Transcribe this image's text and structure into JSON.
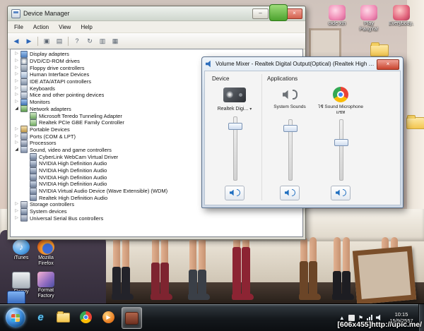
{
  "desktop": {
    "watermark": "[606x455]http://upic.me/",
    "icons": [
      {
        "id": "green-app",
        "label": "",
        "kind": "green-app"
      },
      {
        "id": "doll1",
        "label": "oide xth",
        "kind": "doll-pink"
      },
      {
        "id": "pangya",
        "label": "Play PangYa!",
        "kind": "doll-pink"
      },
      {
        "id": "everybody",
        "label": "Everybody...",
        "kind": "doll-red"
      },
      {
        "id": "folder1",
        "label": "",
        "kind": "folder"
      },
      {
        "id": "folder2",
        "label": "",
        "kind": "folder"
      },
      {
        "id": "itunes",
        "label": "iTunes",
        "kind": "itunes"
      },
      {
        "id": "firefox",
        "label": "Mozilla Firefox",
        "kind": "firefox"
      },
      {
        "id": "grayapp",
        "label": "Floppy",
        "kind": "gray-app"
      },
      {
        "id": "formatfactory",
        "label": "Format Factory",
        "kind": "formatfactory"
      },
      {
        "id": "blueapp",
        "label": "",
        "kind": "blue-app"
      }
    ]
  },
  "device_manager": {
    "title": "Device Manager",
    "menu": [
      "File",
      "Action",
      "View",
      "Help"
    ],
    "toolbar": [
      "back",
      "forward",
      "sep",
      "window",
      "export",
      "sep",
      "help",
      "refresh",
      "scan",
      "properties"
    ],
    "tree": [
      {
        "label": "Display adapters",
        "indent": 1,
        "expand": "collapsed",
        "icon": "display"
      },
      {
        "label": "DVD/CD-ROM drives",
        "indent": 1,
        "expand": "collapsed",
        "icon": "dvd"
      },
      {
        "label": "Floppy drive controllers",
        "indent": 1,
        "expand": "collapsed",
        "icon": "floppy"
      },
      {
        "label": "Human Interface Devices",
        "indent": 1,
        "expand": "collapsed",
        "icon": "hid"
      },
      {
        "label": "IDE ATA/ATAPI controllers",
        "indent": 1,
        "expand": "collapsed",
        "icon": "ide"
      },
      {
        "label": "Keyboards",
        "indent": 1,
        "expand": "collapsed",
        "icon": "keyboard"
      },
      {
        "label": "Mice and other pointing devices",
        "indent": 1,
        "expand": "collapsed",
        "icon": "mouse"
      },
      {
        "label": "Monitors",
        "indent": 1,
        "expand": "collapsed",
        "icon": "monitor"
      },
      {
        "label": "Network adapters",
        "indent": 1,
        "expand": "expanded",
        "icon": "network"
      },
      {
        "label": "Microsoft Teredo Tunneling Adapter",
        "indent": 2,
        "icon": "netdev"
      },
      {
        "label": "Realtek PCIe GBE Family Controller",
        "indent": 2,
        "icon": "netdev"
      },
      {
        "label": "Portable Devices",
        "indent": 1,
        "expand": "collapsed",
        "icon": "portable"
      },
      {
        "label": "Ports (COM & LPT)",
        "indent": 1,
        "expand": "collapsed",
        "icon": "ports"
      },
      {
        "label": "Processors",
        "indent": 1,
        "expand": "collapsed",
        "icon": "processor"
      },
      {
        "label": "Sound, video and game controllers",
        "indent": 1,
        "expand": "expanded",
        "icon": "audio"
      },
      {
        "label": "CyberLink WebCam Virtual Driver",
        "indent": 2,
        "icon": "audiodev"
      },
      {
        "label": "NVIDIA High Definition Audio",
        "indent": 2,
        "icon": "audiodev"
      },
      {
        "label": "NVIDIA High Definition Audio",
        "indent": 2,
        "icon": "audiodev"
      },
      {
        "label": "NVIDIA High Definition Audio",
        "indent": 2,
        "icon": "audiodev"
      },
      {
        "label": "NVIDIA High Definition Audio",
        "indent": 2,
        "icon": "audiodev"
      },
      {
        "label": "NVIDIA Virtual Audio Device (Wave Extensible) (WDM)",
        "indent": 2,
        "icon": "audiodev"
      },
      {
        "label": "Realtek High Definition Audio",
        "indent": 2,
        "icon": "audiodev"
      },
      {
        "label": "Storage controllers",
        "indent": 1,
        "expand": "collapsed",
        "icon": "storage"
      },
      {
        "label": "System devices",
        "indent": 1,
        "expand": "collapsed",
        "icon": "system"
      },
      {
        "label": "Universal Serial Bus controllers",
        "indent": 1,
        "expand": "collapsed",
        "icon": "usb"
      }
    ]
  },
  "volume_mixer": {
    "title": "Volume Mixer - Realtek Digital Output(Optical) (Realtek High Definition A...",
    "sections": {
      "device": "Device",
      "applications": "Applications"
    },
    "channels": [
      {
        "name": "Realtek Digi...",
        "kind": "device-speaker",
        "combo": true,
        "level": 82
      },
      {
        "name": "System Sounds",
        "kind": "system-sounds",
        "combo": false,
        "level": 82
      },
      {
        "name": "ใช้ Sound Microphone แชท",
        "kind": "chrome",
        "combo": false,
        "level": 60
      }
    ]
  },
  "taskbar": {
    "buttons": [
      {
        "id": "ie",
        "active": false
      },
      {
        "id": "explorer",
        "active": false
      },
      {
        "id": "chrome",
        "active": false
      },
      {
        "id": "wmp",
        "active": false
      },
      {
        "id": "app",
        "active": true
      }
    ],
    "tray": [
      "hidden-icons",
      "language",
      "action-center",
      "network",
      "volume"
    ],
    "clock_time": "10:15",
    "clock_date": "15/9/2557"
  }
}
